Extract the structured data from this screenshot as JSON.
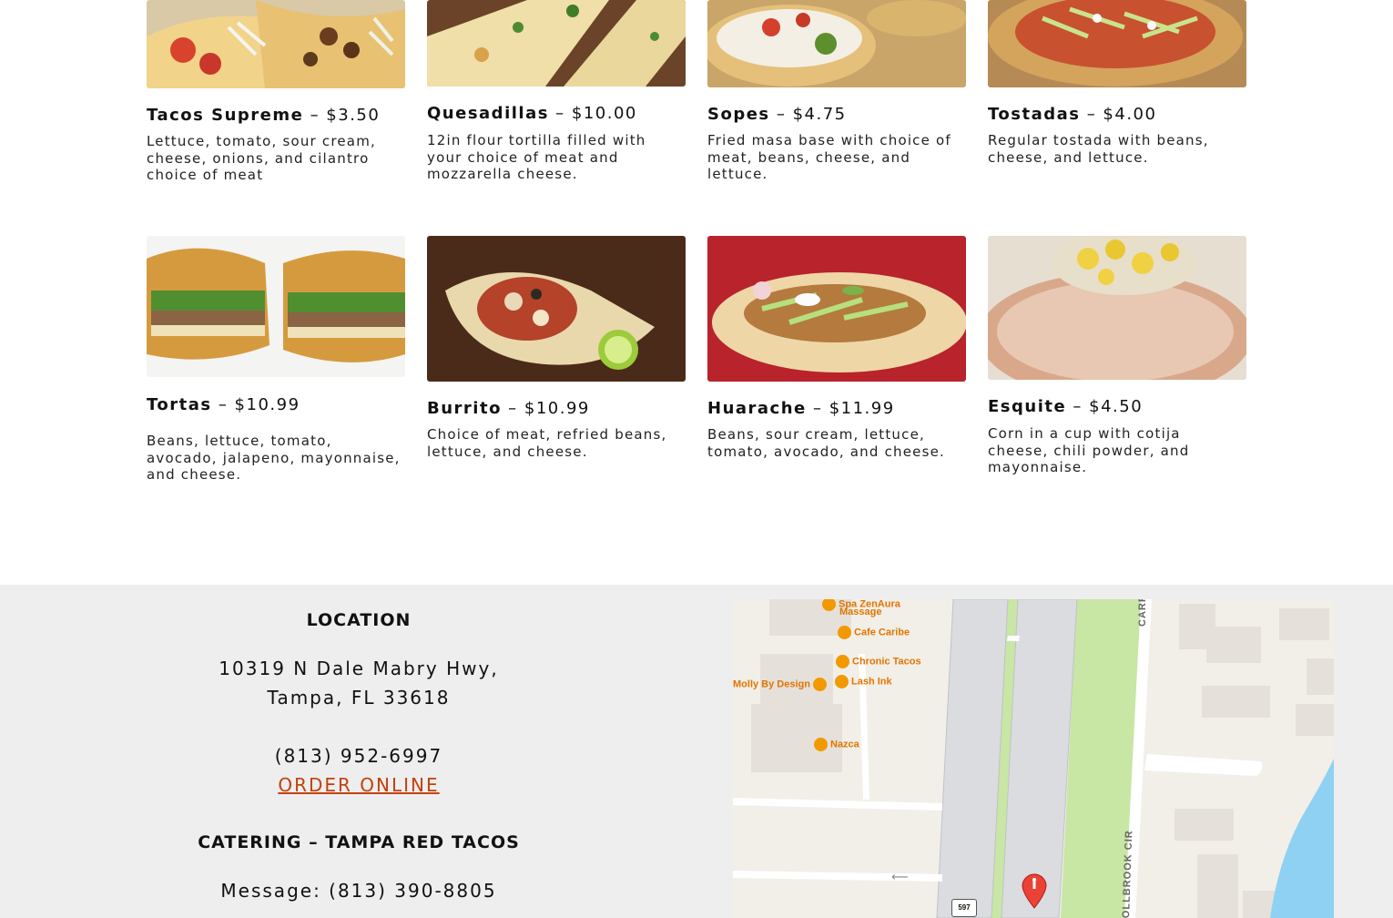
{
  "menu": {
    "items": [
      {
        "name": "Tacos Supreme",
        "price": " – $3.50",
        "desc": "Lettuce, tomato, sour cream, cheese, onions, and cilantro choice of meat",
        "icon": "tacos-photo"
      },
      {
        "name": "Quesadillas",
        "price": " – $10.00",
        "desc": "12in flour tortilla filled with your choice of meat and mozzarella cheese.",
        "icon": "quesadilla-photo"
      },
      {
        "name": "Sopes",
        "price": " – $4.75",
        "desc": "Fried masa base with choice of meat, beans, cheese, and lettuce.",
        "icon": "sopes-photo"
      },
      {
        "name": "Tostadas",
        "price": " – $4.00",
        "desc": "Regular tostada with beans, cheese, and lettuce.",
        "icon": "tostadas-photo"
      },
      {
        "name": "Tortas",
        "price": " – $10.99",
        "desc": "Beans, lettuce, tomato, avocado, jalapeno, mayonnaise, and cheese.",
        "icon": "torta-photo"
      },
      {
        "name": "Burrito",
        "price": " – $10.99",
        "desc": "Choice of meat, refried beans, lettuce, and cheese.",
        "icon": "burrito-photo"
      },
      {
        "name": "Huarache",
        "price": " – $11.99",
        "desc": "Beans, sour cream, lettuce, tomato, avocado, and cheese.",
        "icon": "huarache-photo"
      },
      {
        "name": "Esquite",
        "price": " – $4.50",
        "desc": "Corn in a cup with cotija cheese, chili powder, and mayonnaise.",
        "icon": "esquite-photo"
      }
    ]
  },
  "location": {
    "heading": "LOCATION",
    "address_line1": "10319 N Dale Mabry Hwy,",
    "address_line2": "Tampa, FL 33618",
    "phone": "(813) 952-6997",
    "order_online": "ORDER ONLINE",
    "catering_heading": "CATERING – TAMPA RED TACOS",
    "message": "Message: (813) 390-8805"
  },
  "map": {
    "places": [
      "Spa ZenAura",
      "Massage",
      "Cafe Caribe",
      "Chronic Tacos",
      "Molly By Design",
      "Lash Ink",
      "Nazca"
    ],
    "street_top": "CARR",
    "street_side": "OLLBROOK CIR",
    "route_shield": "597",
    "colors": {
      "poi": "#e37400",
      "road": "#dadce0",
      "park": "#c8e6a4",
      "water": "#8fd1f2",
      "pin": "#ea4335"
    }
  },
  "colors": {
    "accent_link": "#c2410c",
    "footer_bg": "#eeeeee"
  }
}
